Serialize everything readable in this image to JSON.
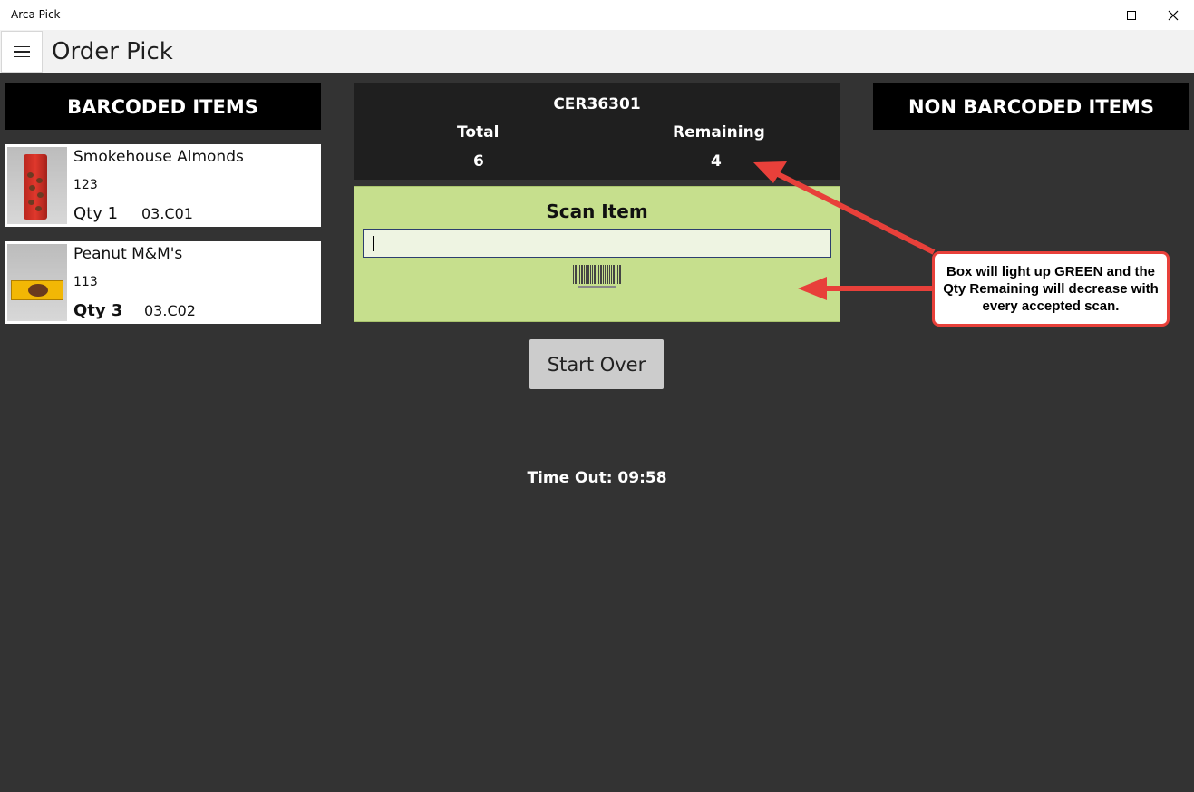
{
  "window": {
    "title": "Arca Pick"
  },
  "appbar": {
    "page_title": "Order Pick"
  },
  "barcoded": {
    "header": "BARCODED ITEMS",
    "items": [
      {
        "name": "Smokehouse Almonds",
        "code": "123",
        "qty_label": "Qty 1",
        "location": "03.C01",
        "image_icon": "almonds-package-image"
      },
      {
        "name": "Peanut M&M's",
        "code": "113",
        "qty_label": "Qty 3",
        "location": "03.C02",
        "image_icon": "mm-package-image"
      }
    ]
  },
  "order": {
    "id": "CER36301",
    "total_label": "Total",
    "total_value": "6",
    "remaining_label": "Remaining",
    "remaining_value": "4"
  },
  "scan": {
    "title": "Scan Item",
    "input_value": "",
    "barcode_icon": "barcode-icon",
    "active_color": "#c6df8d"
  },
  "actions": {
    "start_over_label": "Start Over"
  },
  "timeout": {
    "text": "Time Out: 09:58"
  },
  "non_barcoded": {
    "header": "NON BARCODED ITEMS"
  },
  "annotation": {
    "text": "Box will light up GREEN and the Qty Remaining will decrease with every accepted scan.",
    "accent_color": "#e8403a"
  }
}
